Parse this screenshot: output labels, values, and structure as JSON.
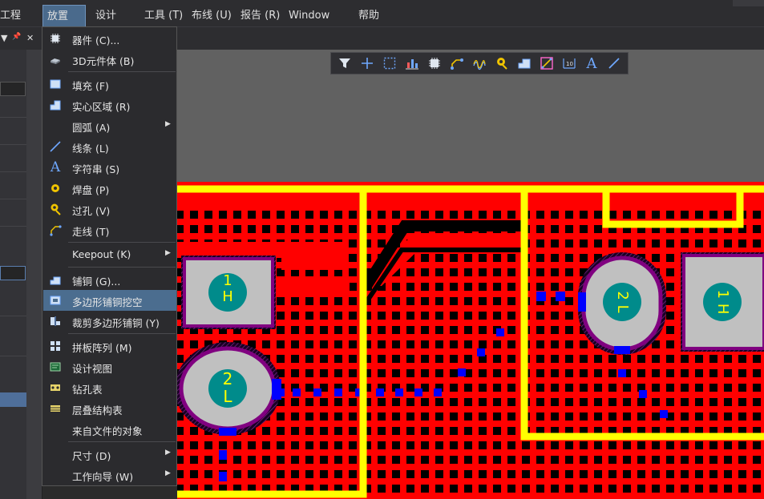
{
  "menubar": {
    "items": [
      {
        "label": "工程 (C)"
      },
      {
        "label": "放置 (P)"
      },
      {
        "label": "设计 (D)"
      },
      {
        "label": "工具 (T)"
      },
      {
        "label": "布线 (U)"
      },
      {
        "label": "报告 (R)"
      },
      {
        "label": "Window (W)"
      },
      {
        "label": "帮助 (H)"
      }
    ]
  },
  "panel": {
    "dropdown": "▼",
    "pin": "📌",
    "close": "✕"
  },
  "place_menu": {
    "items": [
      {
        "label": "器件 (C)...",
        "icon": "component-icon"
      },
      {
        "label": "3D元件体 (B)",
        "icon": "3d-body-icon"
      },
      {
        "label": "填充 (F)",
        "icon": "fill-icon"
      },
      {
        "label": "实心区域 (R)",
        "icon": "solid-region-icon"
      },
      {
        "label": "圆弧 (A)",
        "icon": "arc-icon",
        "submenu": true
      },
      {
        "label": "线条 (L)",
        "icon": "line-icon"
      },
      {
        "label": "字符串 (S)",
        "icon": "string-icon"
      },
      {
        "label": "焊盘 (P)",
        "icon": "pad-icon"
      },
      {
        "label": "过孔 (V)",
        "icon": "via-icon"
      },
      {
        "label": "走线 (T)",
        "icon": "track-icon"
      },
      {
        "label": "Keepout (K)",
        "icon": "",
        "submenu": true
      },
      {
        "label": "铺铜 (G)...",
        "icon": "polygon-pour-icon"
      },
      {
        "label": "多边形铺铜挖空",
        "icon": "polygon-cutout-icon",
        "highlighted": true
      },
      {
        "label": "裁剪多边形铺铜 (Y)",
        "icon": "slice-polygon-icon"
      },
      {
        "label": "拼板阵列 (M)",
        "icon": "panel-array-icon"
      },
      {
        "label": "设计视图",
        "icon": "design-view-icon"
      },
      {
        "label": "钻孔表",
        "icon": "drill-table-icon"
      },
      {
        "label": "层叠结构表",
        "icon": "layer-stack-table-icon"
      },
      {
        "label": "来自文件的对象",
        "icon": ""
      },
      {
        "label": "尺寸 (D)",
        "icon": "",
        "submenu": true
      },
      {
        "label": "工作向导 (W)",
        "icon": "",
        "submenu": true
      }
    ],
    "submenu_arrow": "▶"
  },
  "toolbar": {
    "icons": [
      "filter-icon",
      "crosshair-icon",
      "select-rect-icon",
      "align-icon",
      "component-icon",
      "route-icon",
      "diff-pair-icon",
      "via-icon",
      "polygon-pour-icon",
      "keepout-icon",
      "dimension-icon",
      "string-icon",
      "line-icon"
    ],
    "string_glyph": "A"
  },
  "pcb": {
    "pads": [
      {
        "line1": "1",
        "line2": "H"
      },
      {
        "line1": "2",
        "line2": "L"
      },
      {
        "line1": "2",
        "line2": "L"
      },
      {
        "line1": "1",
        "line2": "H"
      }
    ]
  },
  "colors": {
    "copper_top": "#ff0000",
    "board_outline": "#ffff00",
    "clearance": "#000000",
    "bottom_copper": "#0000ff",
    "pad_fill": "#c0c0c0",
    "pad_hole": "#008b8b",
    "pad_ring": "#800080",
    "pad_text": "#ffff00",
    "menu_highlight": "#4b6d8f"
  }
}
